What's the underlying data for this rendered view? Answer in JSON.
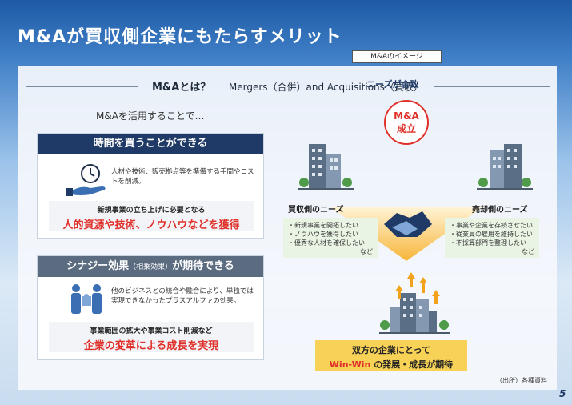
{
  "title": "M&Aが買収側企業にもたらすメリット",
  "subtitle": {
    "main": "M&Aとは？",
    "english": "Mergers（合併）and Acquisitions（買収）"
  },
  "intro": "M&Aを活用することで…",
  "card1": {
    "header": "時間を買うことができる",
    "desc": "人材や技術、販売拠点等を準備する手間やコストを削減。",
    "highlight_small": "新規事業の立ち上げに必要となる",
    "highlight_big": "人的資源や技術、ノウハウなどを獲得"
  },
  "card2": {
    "header_main": "シナジー効果",
    "header_paren": "（相乗効果）",
    "header_tail": "が期待できる",
    "desc": "他のビジネスとの統合や融合により、単独では実現できなかったプラスアルファの効果。",
    "highlight_small": "事業範囲の拡大や事業コスト削減など",
    "highlight_big": "企業の変革による成長を実現"
  },
  "image": {
    "label": "M&Aのイメージ",
    "needs_match": "ニーズが合致",
    "circle_line1": "M&A",
    "circle_line2": "成立",
    "buyer_label": "買収側のニーズ",
    "buyer_items": [
      "・新規事業を開拓したい",
      "・ノウハウを獲得したい",
      "・優秀な人材を確保したい"
    ],
    "buyer_etc": "など",
    "seller_label": "売却側のニーズ",
    "seller_items": [
      "・事業や企業を存続させたい",
      "・従業員の雇用を維持したい",
      "・不採算部門を整理したい"
    ],
    "seller_etc": "など"
  },
  "result": {
    "line1": "双方の企業にとって",
    "winwin": "Win-Win",
    "line2_tail": "の発展・成長が期待"
  },
  "source": "（出所）各種資料",
  "page_number": "5",
  "colors": {
    "navy": "#1f3a66",
    "red": "#e0302a",
    "yellow": "#f7d257",
    "gray_header": "#5b6b80",
    "green_light": "#eaf4e4"
  }
}
